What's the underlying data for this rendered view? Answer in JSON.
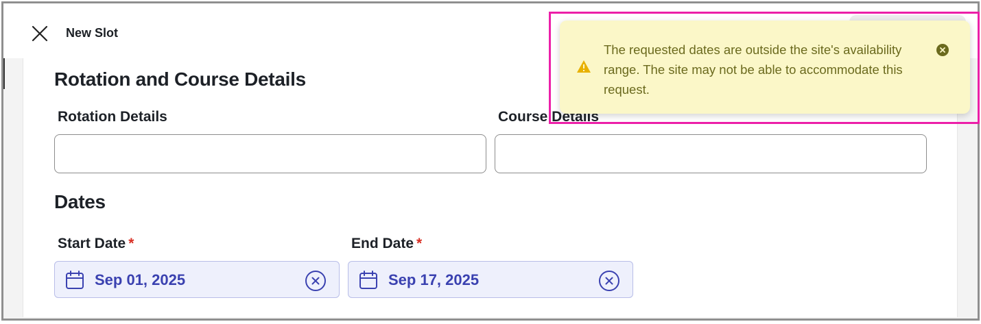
{
  "header": {
    "title": "New Slot",
    "close_icon": "close-icon"
  },
  "rotation_section": {
    "title": "Rotation and Course Details",
    "rotation_label": "Rotation Details",
    "rotation_value": "",
    "course_label": "Course Details",
    "course_value": ""
  },
  "dates_section": {
    "title": "Dates",
    "start_label": "Start Date",
    "start_required": "*",
    "start_value": "Sep 01, 2025",
    "end_label": "End Date",
    "end_required": "*",
    "end_value": "Sep 17, 2025",
    "calendar_icon": "calendar-icon",
    "clear_icon": "clear-circle-icon"
  },
  "toast": {
    "message": "The requested dates are outside the site's availability range. The site may not be able to accommodate this request.",
    "warning_icon": "warning-triangle-icon",
    "dismiss_icon": "dismiss-icon",
    "background_color": "#fbf7c8",
    "text_color": "#6b6a1e"
  },
  "colors": {
    "highlight_border": "#ec1fa8",
    "date_text": "#3a41b0",
    "required_asterisk": "#d93025"
  }
}
